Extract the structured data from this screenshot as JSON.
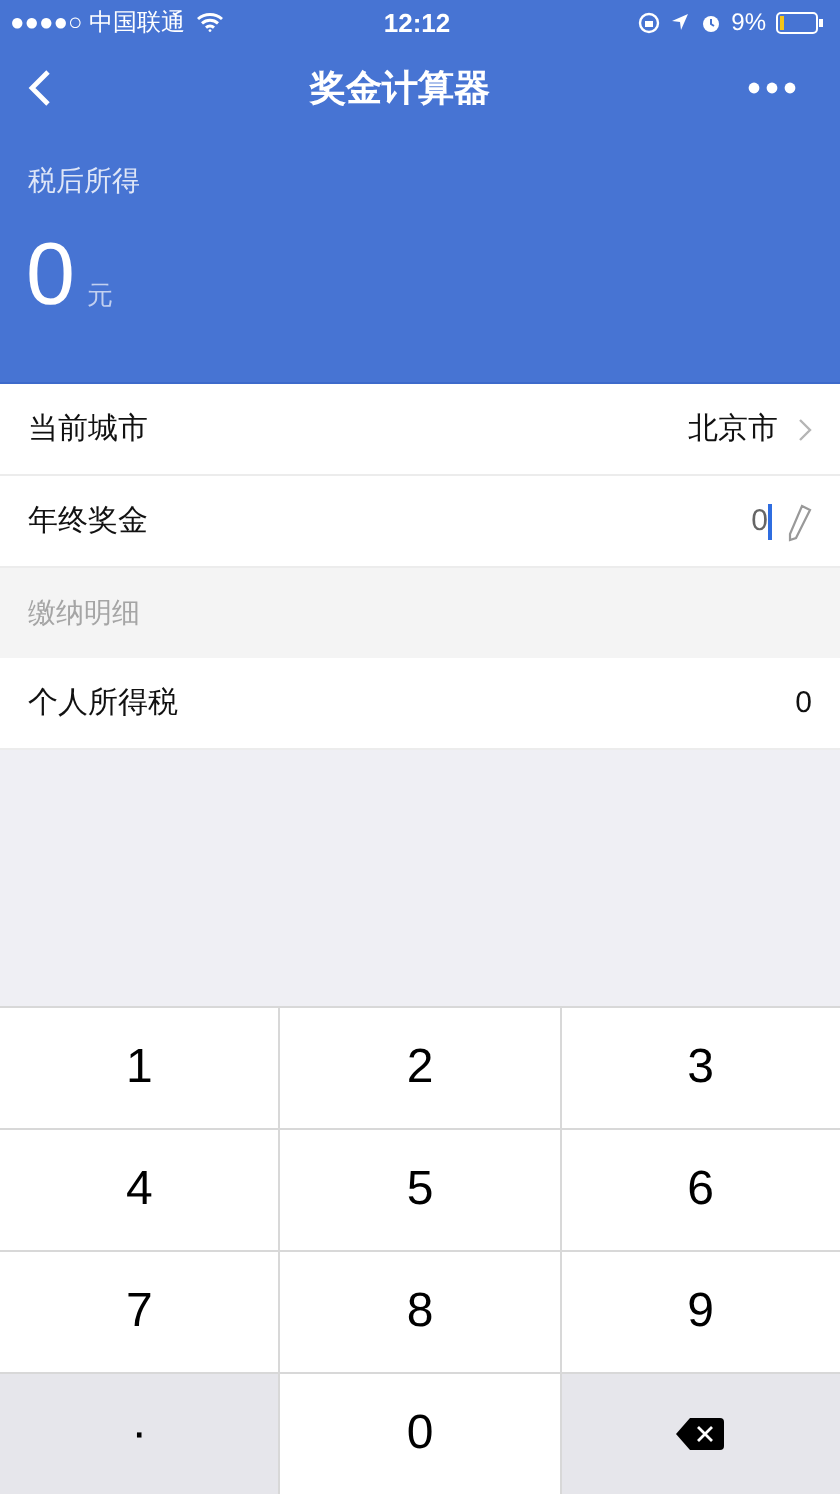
{
  "status_bar": {
    "carrier": "●●●●○ 中国联通",
    "time": "12:12",
    "battery": "9%"
  },
  "nav": {
    "title": "奖金计算器"
  },
  "summary": {
    "label": "税后所得",
    "amount": "0",
    "unit": "元"
  },
  "rows": [
    {
      "kind": "link",
      "label": "当前城市",
      "value": "北京市"
    },
    {
      "kind": "input",
      "label": "年终奖金",
      "value": "0"
    },
    {
      "kind": "section",
      "label": "缴纳明细"
    },
    {
      "kind": "plain",
      "label": "个人所得税",
      "value": "0"
    }
  ],
  "keypad": [
    {
      "kind": "digit",
      "label": "1"
    },
    {
      "kind": "digit",
      "label": "2"
    },
    {
      "kind": "digit",
      "label": "3"
    },
    {
      "kind": "digit",
      "label": "4"
    },
    {
      "kind": "digit",
      "label": "5"
    },
    {
      "kind": "digit",
      "label": "6"
    },
    {
      "kind": "digit",
      "label": "7"
    },
    {
      "kind": "digit",
      "label": "8"
    },
    {
      "kind": "digit",
      "label": "9"
    },
    {
      "kind": "dot",
      "label": "·"
    },
    {
      "kind": "digit",
      "label": "0"
    },
    {
      "kind": "backspace"
    }
  ]
}
